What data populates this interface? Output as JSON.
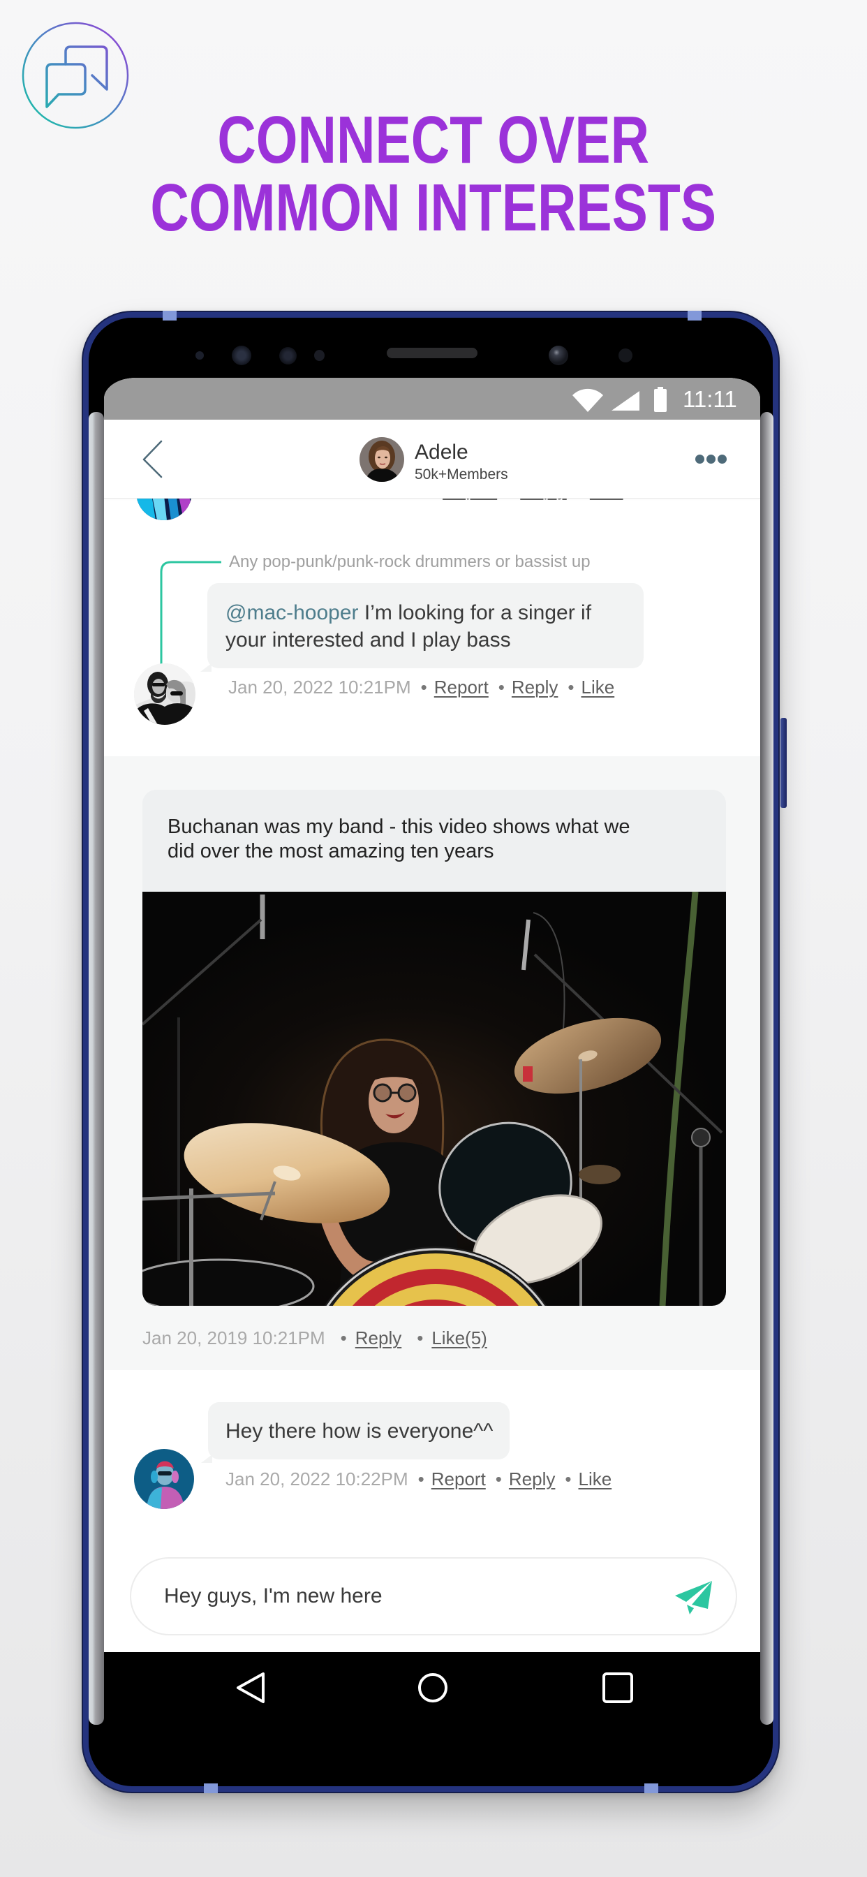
{
  "promo": {
    "logo_icon": "chat-bubbles-icon",
    "headline_line1": "CONNECT OVER",
    "headline_line2": "COMMON INTERESTS"
  },
  "colors": {
    "headline_purple": "#9b32d9",
    "accent_teal": "#2cc6a0",
    "mention_slate": "#4e7d8c",
    "status_bar_grey": "#9b9b9b",
    "phone_rim_navy": "#24337e"
  },
  "status_bar": {
    "time": "11:11",
    "icons": [
      "wifi-icon",
      "signal-icon",
      "battery-icon"
    ]
  },
  "header": {
    "back_icon": "chevron-left-icon",
    "title": "Adele",
    "subtitle": "50k+Members",
    "more_icon": "more-horizontal-icon"
  },
  "feed": {
    "previous_comment": {
      "actions": [
        "Report",
        "Reply",
        "Like"
      ]
    },
    "reply_comment": {
      "quoted_text": "Any pop-punk/punk-rock drummers or bassist up",
      "mention": "@mac-hooper",
      "text": "I’m looking for a singer if your interested and I play bass",
      "timestamp": "Jan 20, 2022 10:21PM",
      "actions": [
        "Report",
        "Reply",
        "Like"
      ]
    },
    "post": {
      "text": "Buchanan was my band - this video shows what we did over the most amazing ten years",
      "media": "photo of a drummer performing on stage",
      "timestamp": "Jan 20, 2019 10:21PM",
      "actions": [
        "Reply",
        "Like(5)"
      ]
    },
    "comment": {
      "text": "Hey there how is everyone^^",
      "timestamp": "Jan 20, 2022 10:22PM",
      "actions": [
        "Report",
        "Reply",
        "Like"
      ]
    }
  },
  "composer": {
    "value": "Hey guys, I'm new here",
    "send_icon": "send-icon"
  },
  "nav_bar": {
    "icons": [
      "back-icon",
      "home-icon",
      "recents-icon"
    ]
  }
}
